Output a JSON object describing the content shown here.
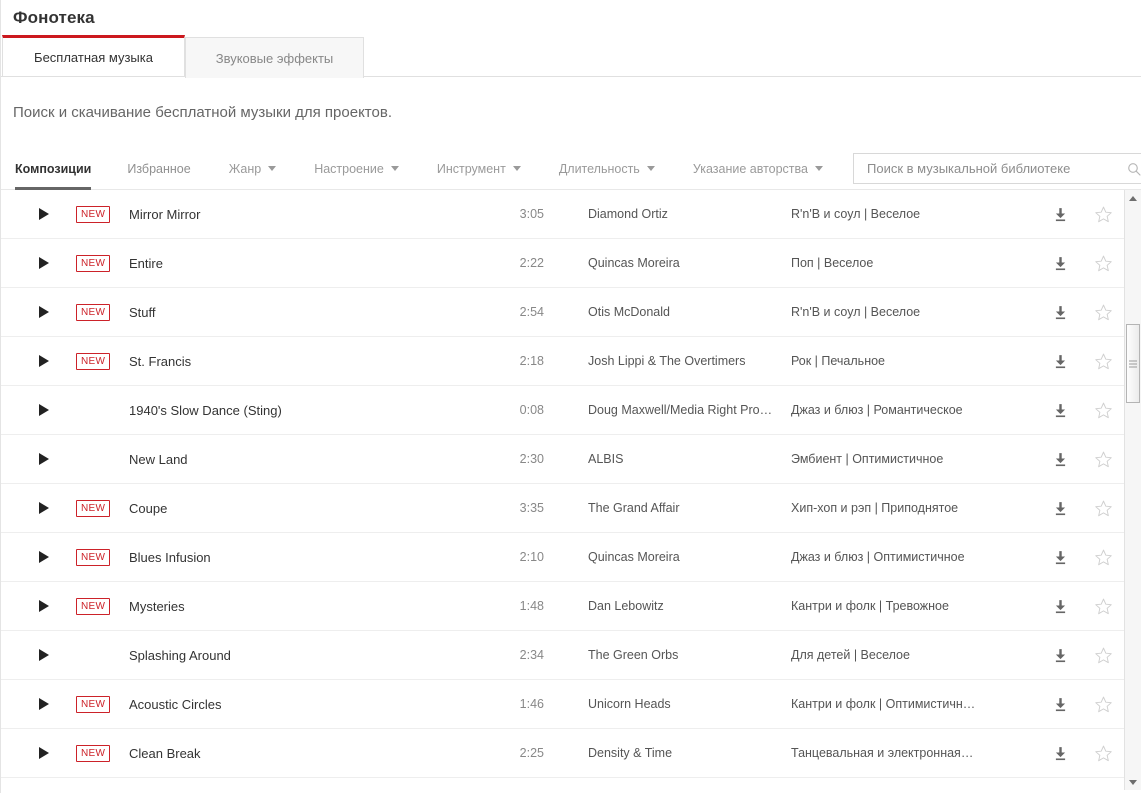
{
  "header": {
    "title": "Фонотека",
    "tabs": [
      {
        "label": "Бесплатная музыка",
        "active": true
      },
      {
        "label": "Звуковые эффекты",
        "active": false
      }
    ],
    "subtitle": "Поиск и скачивание бесплатной музыки для проектов.",
    "accent_color": "#cc181e"
  },
  "filters": {
    "tabs": [
      {
        "label": "Композиции",
        "selected": true
      },
      {
        "label": "Избранное",
        "selected": false
      }
    ],
    "dropdowns": [
      {
        "label": "Жанр"
      },
      {
        "label": "Настроение"
      },
      {
        "label": "Инструмент"
      },
      {
        "label": "Длительность"
      },
      {
        "label": "Указание авторства"
      }
    ],
    "search": {
      "placeholder": "Поиск в музыкальной библиотеке",
      "value": ""
    }
  },
  "tracks": [
    {
      "new": "NEW",
      "title": "Mirror Mirror",
      "duration": "3:05",
      "artist": "Diamond Ortiz",
      "genre": "R'n'B и соул | Веселое"
    },
    {
      "new": "NEW",
      "title": "Entire",
      "duration": "2:22",
      "artist": "Quincas Moreira",
      "genre": "Поп | Веселое"
    },
    {
      "new": "NEW",
      "title": "Stuff",
      "duration": "2:54",
      "artist": "Otis McDonald",
      "genre": "R'n'B и соул | Веселое"
    },
    {
      "new": "NEW",
      "title": "St. Francis",
      "duration": "2:18",
      "artist": "Josh Lippi & The Overtimers",
      "genre": "Рок | Печальное"
    },
    {
      "new": "",
      "title": "1940's Slow Dance (Sting)",
      "duration": "0:08",
      "artist": "Doug Maxwell/Media Right Productio…",
      "genre": "Джаз и блюз | Романтическое"
    },
    {
      "new": "",
      "title": "New Land",
      "duration": "2:30",
      "artist": "ALBIS",
      "genre": "Эмбиент | Оптимистичное"
    },
    {
      "new": "NEW",
      "title": "Coupe",
      "duration": "3:35",
      "artist": "The Grand Affair",
      "genre": "Хип-хоп и рэп | Приподнятое"
    },
    {
      "new": "NEW",
      "title": "Blues Infusion",
      "duration": "2:10",
      "artist": "Quincas Moreira",
      "genre": "Джаз и блюз | Оптимистичное"
    },
    {
      "new": "NEW",
      "title": "Mysteries",
      "duration": "1:48",
      "artist": "Dan Lebowitz",
      "genre": "Кантри и фолк | Тревожное"
    },
    {
      "new": "",
      "title": "Splashing Around",
      "duration": "2:34",
      "artist": "The Green Orbs",
      "genre": "Для детей | Веселое"
    },
    {
      "new": "NEW",
      "title": "Acoustic Circles",
      "duration": "1:46",
      "artist": "Unicorn Heads",
      "genre": "Кантри и фолк | Оптимистичн…"
    },
    {
      "new": "NEW",
      "title": "Clean Break",
      "duration": "2:25",
      "artist": "Density & Time",
      "genre": "Танцевальная и электронная…"
    }
  ],
  "icons": {
    "play": "play-icon",
    "download": "download-icon",
    "favorite": "star-outline-icon",
    "search": "search-icon",
    "dropdown": "chevron-down-icon",
    "scroll_up": "scroll-up-arrow-icon",
    "scroll_down": "scroll-down-arrow-icon"
  }
}
